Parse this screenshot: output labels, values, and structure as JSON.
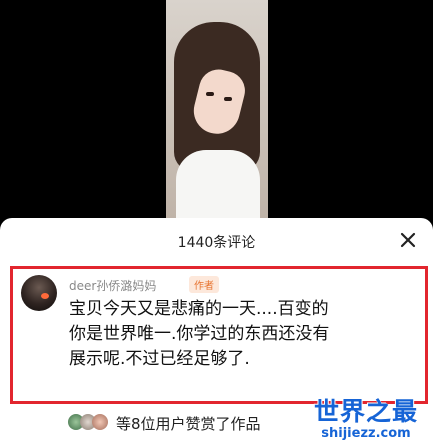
{
  "sheet": {
    "comment_count": "1440条评论"
  },
  "comment": {
    "username": "deer孙侨潞妈妈",
    "badge": "作者",
    "text": "宝贝今天又是悲痛的一天....百变的你是世界唯一.你学过的东西还没有展示呢.不过已经足够了."
  },
  "likes": {
    "text": "等8位用户赞赏了作品"
  },
  "watermark": {
    "title": "世界之最",
    "url": "shijiezz.com"
  },
  "colors": {
    "highlight_border": "#e2262e",
    "author_badge": "#e7732f",
    "watermark": "#1664d6"
  },
  "icons": [
    "close-icon"
  ]
}
